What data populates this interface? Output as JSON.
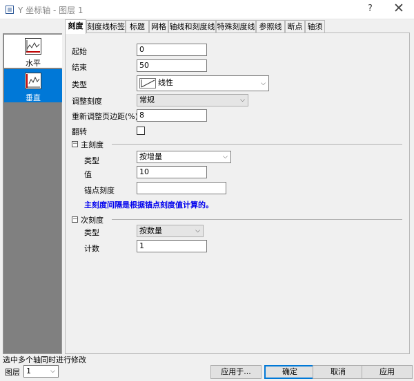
{
  "window": {
    "title": "Y 坐标轴 - 图层 1",
    "help": "?",
    "close": "✕"
  },
  "tabs": [
    {
      "label": "刻度",
      "active": true
    },
    {
      "label": "刻度线标签"
    },
    {
      "label": "标题"
    },
    {
      "label": "网格"
    },
    {
      "label": "轴线和刻度线"
    },
    {
      "label": "特殊刻度线"
    },
    {
      "label": "参照线"
    },
    {
      "label": "断点"
    },
    {
      "label": "轴须"
    }
  ],
  "sidebar": {
    "items": [
      {
        "label": "水平",
        "icon": "horizontal-axis-icon",
        "selected": false
      },
      {
        "label": "垂直",
        "icon": "vertical-axis-icon",
        "selected": true
      }
    ]
  },
  "form": {
    "start": {
      "label": "起始",
      "value": "0"
    },
    "end": {
      "label": "结束",
      "value": "50"
    },
    "type": {
      "label": "类型",
      "value": "线性"
    },
    "rescale": {
      "label": "调整刻度",
      "value": "常规"
    },
    "rescale_margin": {
      "label": "重新调整页边距(%)",
      "value": "8"
    },
    "flip": {
      "label": "翻转",
      "checked": false
    }
  },
  "major": {
    "title": "主刻度",
    "type": {
      "label": "类型",
      "value": "按增量"
    },
    "value": {
      "label": "值",
      "value": "10"
    },
    "anchor": {
      "label": "锚点刻度",
      "value": ""
    },
    "note": "主刻度间隔是根据锚点刻度值计算的。"
  },
  "minor": {
    "title": "次刻度",
    "type": {
      "label": "类型",
      "value": "按数量"
    },
    "count": {
      "label": "计数",
      "value": "1"
    }
  },
  "footer": {
    "status": "选中多个轴同时进行修改",
    "layer_label": "图层",
    "layer_value": "1",
    "apply_to": "应用于...",
    "ok": "确定",
    "cancel": "取消",
    "apply": "应用"
  },
  "colors": {
    "accent": "#0078d7",
    "note": "#0000ee"
  }
}
